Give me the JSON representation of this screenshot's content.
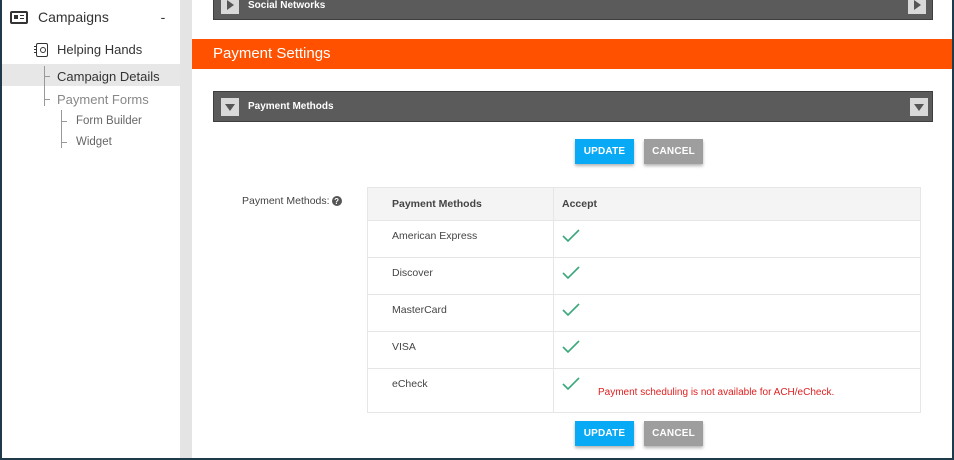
{
  "sidebar": {
    "title": "Campaigns",
    "collapse": "-",
    "campaign": "Helping Hands",
    "items": [
      "Campaign Details",
      "Payment Forms"
    ],
    "subitems": [
      "Form Builder",
      "Widget"
    ]
  },
  "main": {
    "social_label": "Social Networks",
    "section_title": "Payment Settings",
    "panel_label": "Payment Methods",
    "update_label": "UPDATE",
    "cancel_label": "CANCEL",
    "field_label": "Payment Methods:",
    "help": "?",
    "table": {
      "headers": [
        "Payment Methods",
        "Accept"
      ],
      "rows": [
        {
          "method": "American Express",
          "note": ""
        },
        {
          "method": "Discover",
          "note": ""
        },
        {
          "method": "MasterCard",
          "note": ""
        },
        {
          "method": "VISA",
          "note": ""
        },
        {
          "method": "eCheck",
          "note": "Payment scheduling is not available for ACH/eCheck."
        }
      ]
    },
    "colors": {
      "accent": "#ff5100",
      "update": "#09aaf5",
      "cancel": "#9e9e9e",
      "check": "#3aa87a",
      "warning": "#e02020"
    }
  }
}
